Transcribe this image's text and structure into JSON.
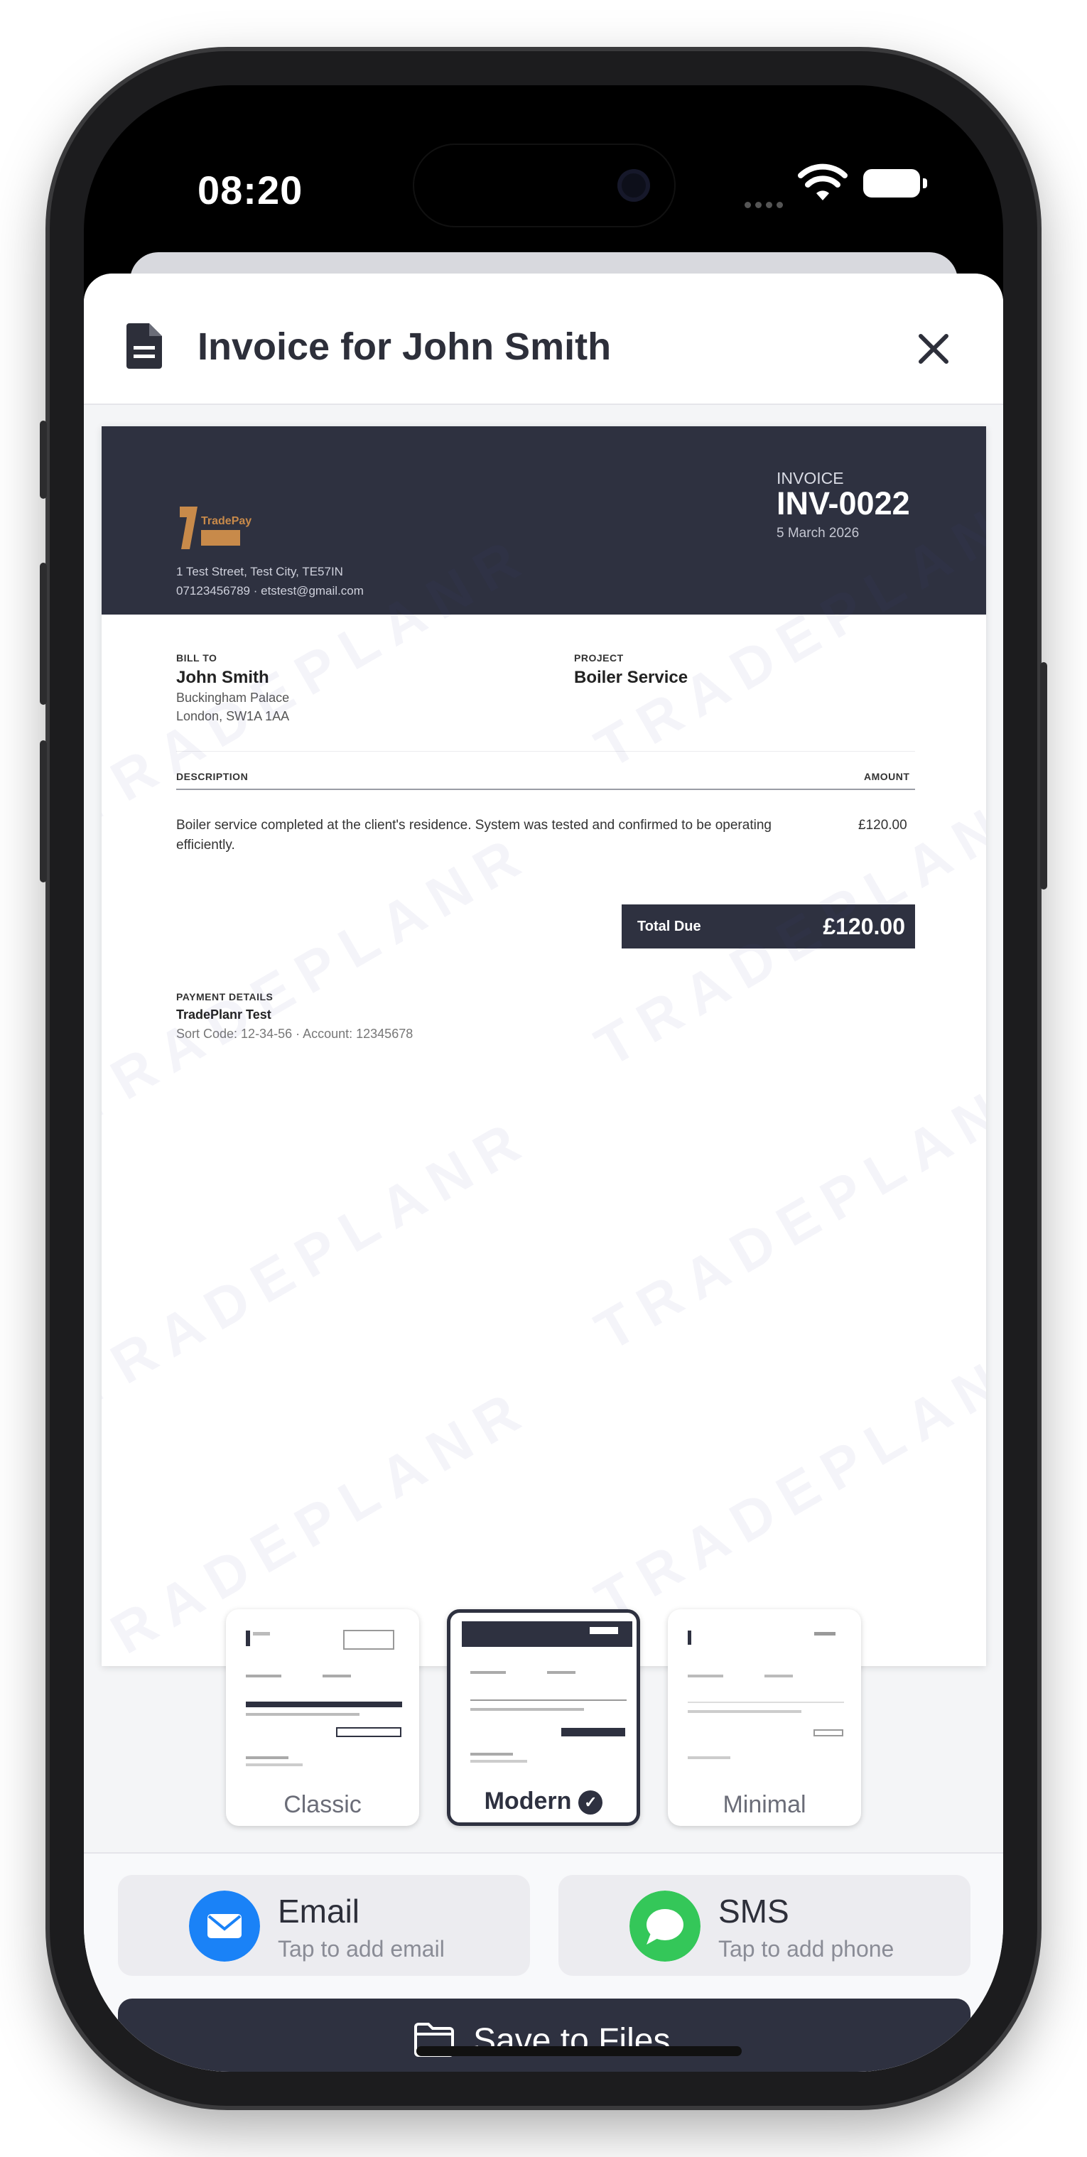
{
  "status_bar": {
    "time": "08:20"
  },
  "sheet": {
    "title": "Invoice for John Smith"
  },
  "invoice": {
    "label": "INVOICE",
    "number": "INV-0022",
    "date": "5 March 2026",
    "business_address": "1 Test Street, Test City, TE57IN",
    "business_contact": "07123456789  ·  etstest@gmail.com",
    "logo_text": "TradePay",
    "bill_to_label": "BILL TO",
    "client_name": "John Smith",
    "client_address_1": "Buckingham Palace",
    "client_address_2": "London, SW1A 1AA",
    "project_label": "PROJECT",
    "project_name": "Boiler Service",
    "description_header": "DESCRIPTION",
    "amount_header": "AMOUNT",
    "line_description": "Boiler service completed at the client's residence. System was tested and confirmed to be operating efficiently.",
    "line_amount": "£120.00",
    "total_label": "Total Due",
    "total_value": "£120.00",
    "payment_label": "PAYMENT DETAILS",
    "payment_name": "TradePlanr Test",
    "payment_details": "Sort Code: 12-34-56  ·  Account: 12345678",
    "watermark": "TRADEPLANR"
  },
  "templates": [
    {
      "label": "Classic",
      "selected": false
    },
    {
      "label": "Modern",
      "selected": true
    },
    {
      "label": "Minimal",
      "selected": false
    }
  ],
  "share": {
    "email": {
      "title": "Email",
      "subtitle": "Tap to add email",
      "color": "#1a82f7"
    },
    "sms": {
      "title": "SMS",
      "subtitle": "Tap to add phone",
      "color": "#34c759"
    }
  },
  "save": {
    "label": "Save to Files"
  },
  "colors": {
    "invoice_dark": "#2e3140",
    "sheet_bg": "#f4f5f7"
  }
}
